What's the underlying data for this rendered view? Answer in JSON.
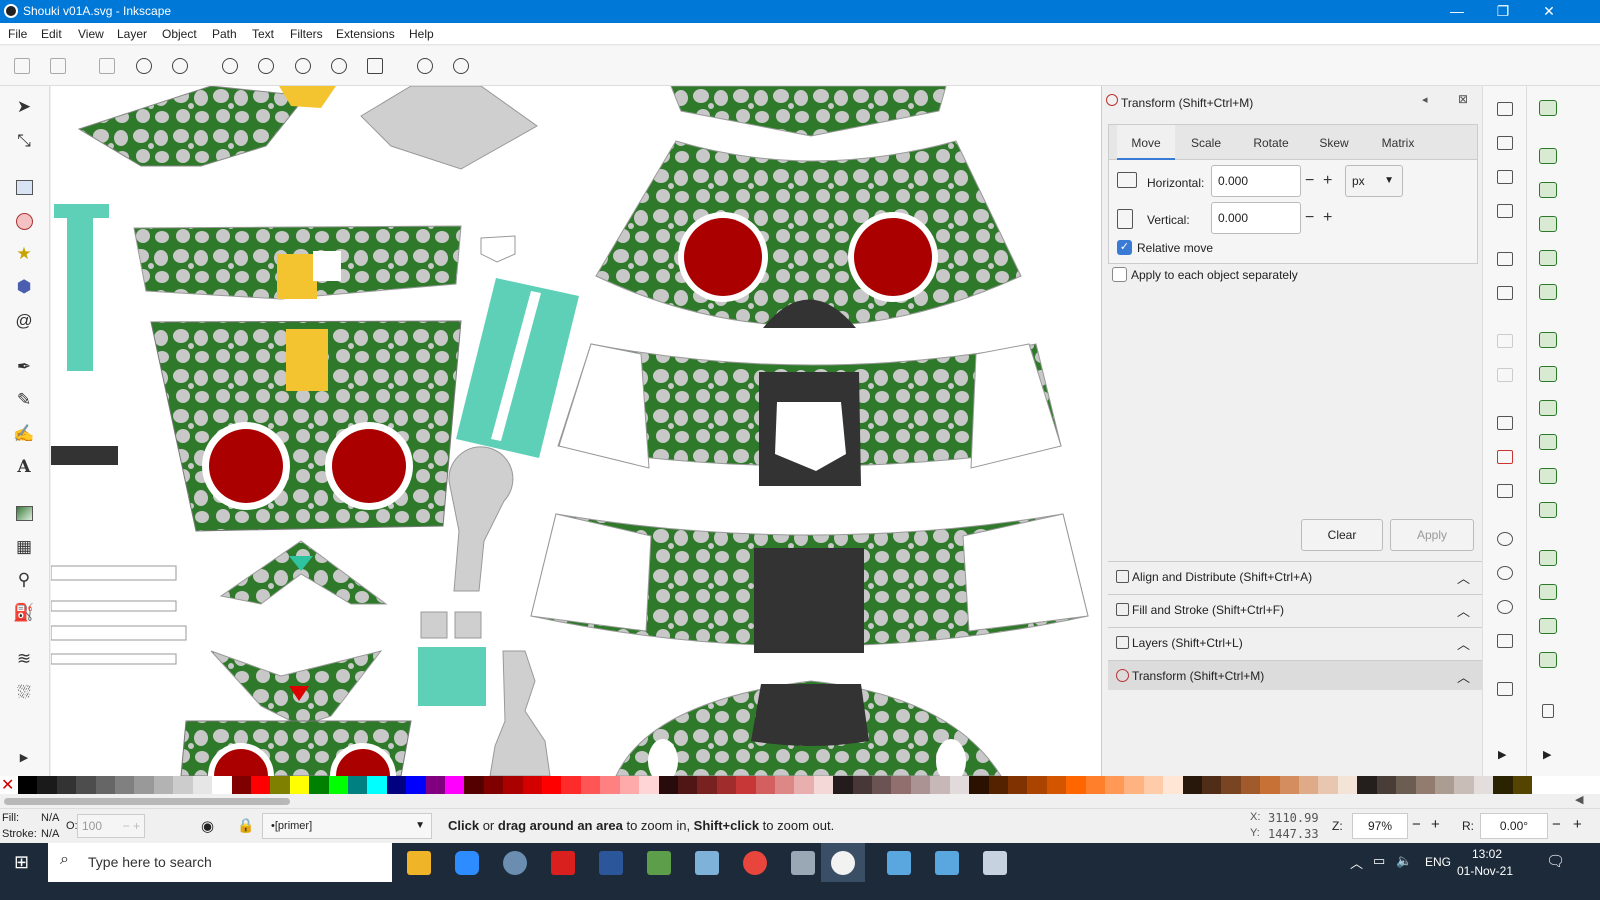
{
  "window": {
    "title": "Shouki v01A.svg - Inkscape",
    "minimize": "—",
    "maximize": "❐",
    "close": "✕"
  },
  "menu": [
    "File",
    "Edit",
    "View",
    "Layer",
    "Object",
    "Path",
    "Text",
    "Filters",
    "Extensions",
    "Help"
  ],
  "transform_dialog": {
    "title": "Transform (Shift+Ctrl+M)",
    "tabs": [
      "Move",
      "Scale",
      "Rotate",
      "Skew",
      "Matrix"
    ],
    "active_tab": "Move",
    "horizontal_label": "Horizontal:",
    "horizontal_value": "0.000",
    "vertical_label": "Vertical:",
    "vertical_value": "0.000",
    "unit": "px",
    "relative_move_label": "Relative move",
    "relative_move_checked": true,
    "apply_each_label": "Apply to each object separately",
    "apply_each_checked": false,
    "clear_label": "Clear",
    "apply_label": "Apply",
    "minus": "−",
    "plus": "+"
  },
  "docked_panels": [
    {
      "label": "Align and Distribute (Shift+Ctrl+A)",
      "icon": "align-icon"
    },
    {
      "label": "Fill and Stroke (Shift+Ctrl+F)",
      "icon": "fill-stroke-icon"
    },
    {
      "label": "Layers (Shift+Ctrl+L)",
      "icon": "layers-icon"
    },
    {
      "label": "Transform (Shift+Ctrl+M)",
      "icon": "transform-icon"
    }
  ],
  "status": {
    "fill_label": "Fill:",
    "fill_value": "N/A",
    "stroke_label": "Stroke:",
    "stroke_value": "N/A",
    "opacity_label": "O:",
    "opacity_value": "100",
    "layer": "•[primer]",
    "message_bold1": "Click",
    "message_mid1": " or ",
    "message_bold2": "drag around an area",
    "message_mid2": " to zoom in, ",
    "message_bold3": "Shift+click",
    "message_end": " to zoom out.",
    "x_label": "X:",
    "x_value": "3110.99",
    "y_label": "Y:",
    "y_value": "1447.33",
    "zoom_label": "Z:",
    "zoom_value": "97%",
    "rotate_label": "R:",
    "rotate_value": "0.00°"
  },
  "taskbar": {
    "search_placeholder": "Type here to search",
    "language": "ENG",
    "time": "13:02",
    "date": "01-Nov-21"
  },
  "palette_colors": [
    "#000000",
    "#1a1a1a",
    "#333333",
    "#4d4d4d",
    "#666666",
    "#808080",
    "#999999",
    "#b3b3b3",
    "#cccccc",
    "#e6e6e6",
    "#ffffff",
    "#800000",
    "#ff0000",
    "#808000",
    "#ffff00",
    "#008000",
    "#00ff00",
    "#008080",
    "#00ffff",
    "#000080",
    "#0000ff",
    "#800080",
    "#ff00ff",
    "#550000",
    "#800000",
    "#aa0000",
    "#d40000",
    "#ff0000",
    "#ff2a2a",
    "#ff5555",
    "#ff8080",
    "#ffaaaa",
    "#ffd5d5",
    "#280b0b",
    "#501616",
    "#782121",
    "#a02c2c",
    "#c83737",
    "#d35f5f",
    "#de8787",
    "#e9afaf",
    "#f4d7d7",
    "#241c1c",
    "#483737",
    "#6c5353",
    "#916f6f",
    "#ac9393",
    "#c8b7b7",
    "#e3dbdb",
    "#2b1100",
    "#552200",
    "#803300",
    "#aa4400",
    "#d45500",
    "#ff6600",
    "#ff7f2a",
    "#ff9955",
    "#ffb380",
    "#ffccaa",
    "#ffe6d5",
    "#28170b",
    "#502d16",
    "#784421",
    "#a05a2c",
    "#c87137",
    "#d38d5f",
    "#deaa87",
    "#e9c6af",
    "#f4e3d7",
    "#241f1c",
    "#483e37",
    "#6c5d53",
    "#917c6f",
    "#ac9d93",
    "#c8beb7",
    "#e3dedb",
    "#2b2200",
    "#554400"
  ]
}
